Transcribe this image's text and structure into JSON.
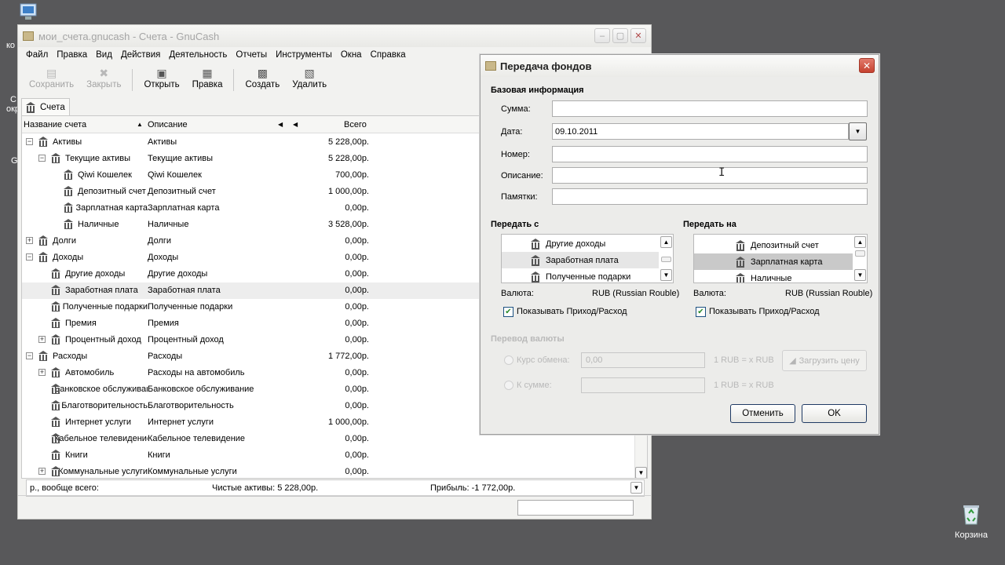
{
  "desktop": {
    "frag1": "ко",
    "frag2": "С",
    "frag3": "окр",
    "frag4": "G",
    "recycle_label": "Корзина"
  },
  "main": {
    "title": "мои_счета.gnucash - Счета - GnuCash",
    "menu": [
      "Файл",
      "Правка",
      "Вид",
      "Действия",
      "Деятельность",
      "Отчеты",
      "Инструменты",
      "Окна",
      "Справка"
    ],
    "toolbar": {
      "save": "Сохранить",
      "close": "Закрыть",
      "open": "Открыть",
      "edit": "Правка",
      "new": "Создать",
      "delete": "Удалить"
    },
    "tab": "Счета",
    "columns": {
      "name": "Название счета",
      "description": "Описание",
      "total": "Всего"
    },
    "accounts": [
      {
        "name": "Активы",
        "desc": "Активы",
        "total": "5 228,00р."
      },
      {
        "name": "Текущие активы",
        "desc": "Текущие активы",
        "total": "5 228,00р."
      },
      {
        "name": "Qiwi Кошелек",
        "desc": "Qiwi Кошелек",
        "total": "700,00р."
      },
      {
        "name": "Депозитный счет",
        "desc": "Депозитный счет",
        "total": "1 000,00р."
      },
      {
        "name": "Зарплатная карта",
        "desc": "Зарплатная карта",
        "total": "0,00р."
      },
      {
        "name": "Наличные",
        "desc": "Наличные",
        "total": "3 528,00р."
      },
      {
        "name": "Долги",
        "desc": "Долги",
        "total": "0,00р."
      },
      {
        "name": "Доходы",
        "desc": "Доходы",
        "total": "0,00р."
      },
      {
        "name": "Другие доходы",
        "desc": "Другие доходы",
        "total": "0,00р."
      },
      {
        "name": "Заработная плата",
        "desc": "Заработная плата",
        "total": "0,00р."
      },
      {
        "name": "Полученные подарки",
        "desc": "Полученные подарки",
        "total": "0,00р."
      },
      {
        "name": "Премия",
        "desc": "Премия",
        "total": "0,00р."
      },
      {
        "name": "Процентный доход",
        "desc": "Процентный доход",
        "total": "0,00р."
      },
      {
        "name": "Расходы",
        "desc": "Расходы",
        "total": "1 772,00р."
      },
      {
        "name": "Автомобиль",
        "desc": "Расходы на автомобиль",
        "total": "0,00р."
      },
      {
        "name": "Банковское обслуживание",
        "desc": "Банковское обслуживание",
        "total": "0,00р."
      },
      {
        "name": "Благотворительность",
        "desc": "Благотворительность",
        "total": "0,00р."
      },
      {
        "name": "Интернет услуги",
        "desc": "Интернет услуги",
        "total": "1 000,00р."
      },
      {
        "name": "Кабельное телевидение",
        "desc": "Кабельное телевидение",
        "total": "0,00р."
      },
      {
        "name": "Книги",
        "desc": "Книги",
        "total": "0,00р."
      },
      {
        "name": "Коммунальные услуги",
        "desc": "Коммунальные услуги",
        "total": "0,00р."
      }
    ],
    "summary": {
      "left": "р., вообще всего:",
      "net": "Чистые активы: 5 228,00р.",
      "profit": "Прибыль: -1 772,00р."
    }
  },
  "dialog": {
    "title": "Передача фондов",
    "section_basic": "Базовая информация",
    "amount_label": "Сумма:",
    "amount_value": "",
    "date_label": "Дата:",
    "date_value": "09.10.2011",
    "number_label": "Номер:",
    "number_value": "",
    "desc_label": "Описание:",
    "desc_value": "",
    "memo_label": "Памятки:",
    "memo_value": "",
    "from_title": "Передать с",
    "to_title": "Передать на",
    "from_items": [
      "Другие доходы",
      "Заработная плата",
      "Полученные подарки"
    ],
    "to_items": [
      "Депозитный счет",
      "Зарплатная карта",
      "Наличные"
    ],
    "currency_label": "Валюта:",
    "from_currency": "RUB (Russian Rouble)",
    "to_currency": "RUB (Russian Rouble)",
    "show_income_label": "Показывать Приход/Расход",
    "fx_title": "Перевод валюты",
    "rate_label": "Курс обмена:",
    "rate_value": "0,00",
    "rate_unit": "1 RUB = x RUB",
    "amount2_label": "К сумме:",
    "amount2_unit": "1 RUB = x RUB",
    "fetch_label": "Загрузить цену",
    "cancel": "Отменить",
    "ok": "OK"
  }
}
